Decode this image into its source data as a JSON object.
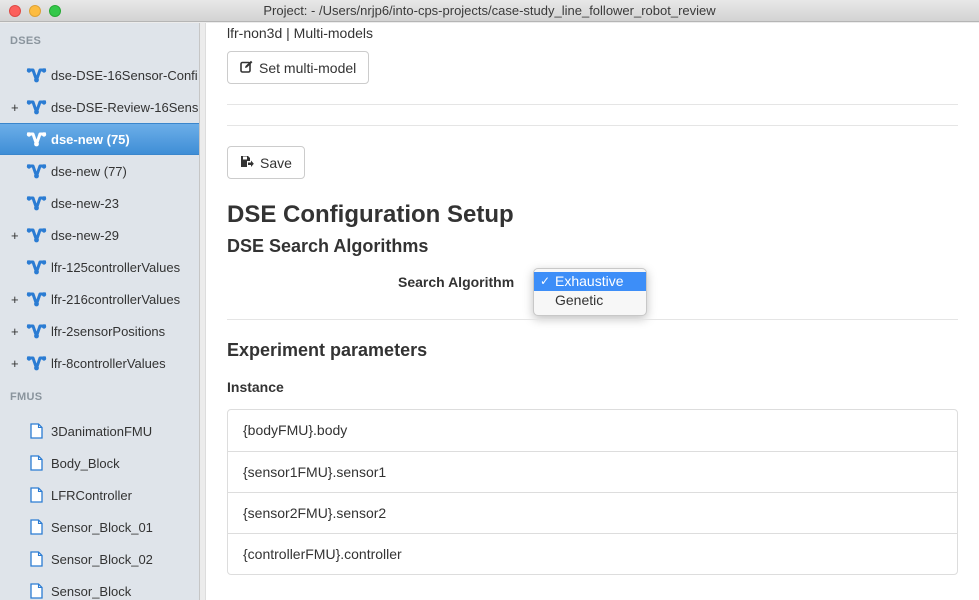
{
  "window": {
    "title": "Project: - /Users/nrjp6/into-cps-projects/case-study_line_follower_robot_review"
  },
  "sidebar": {
    "dses_header": "DSES",
    "dses": [
      {
        "label": "dse-DSE-16Sensor-Confi",
        "expandable": false,
        "selected": false
      },
      {
        "label": "dse-DSE-Review-16Sens",
        "expandable": true,
        "selected": false
      },
      {
        "label": "dse-new (75)",
        "expandable": false,
        "selected": true
      },
      {
        "label": "dse-new (77)",
        "expandable": false,
        "selected": false
      },
      {
        "label": "dse-new-23",
        "expandable": false,
        "selected": false
      },
      {
        "label": "dse-new-29",
        "expandable": true,
        "selected": false
      },
      {
        "label": "lfr-125controllerValues",
        "expandable": false,
        "selected": false
      },
      {
        "label": "lfr-216controllerValues",
        "expandable": true,
        "selected": false
      },
      {
        "label": "lfr-2sensorPositions",
        "expandable": true,
        "selected": false
      },
      {
        "label": "lfr-8controllerValues",
        "expandable": true,
        "selected": false
      }
    ],
    "fmus_header": "FMUS",
    "fmus": [
      {
        "label": "3DanimationFMU"
      },
      {
        "label": "Body_Block"
      },
      {
        "label": "LFRController"
      },
      {
        "label": "Sensor_Block_01"
      },
      {
        "label": "Sensor_Block_02"
      },
      {
        "label": "Sensor_Block"
      }
    ],
    "expand_glyph": "+"
  },
  "main": {
    "breadcrumb": "lfr-non3d | Multi-models",
    "set_multimodel_label": "Set multi-model",
    "save_label": "Save",
    "config_title": "DSE Configuration Setup",
    "search_algorithms_title": "DSE Search Algorithms",
    "search_algorithm_label": "Search Algorithm",
    "search_algorithm_options": [
      "Exhaustive",
      "Genetic"
    ],
    "search_algorithm_selected": "Exhaustive",
    "experiment_title": "Experiment parameters",
    "instance_label": "Instance",
    "instances": [
      "{bodyFMU}.body",
      "{sensor1FMU}.sensor1",
      "{sensor2FMU}.sensor2",
      "{controllerFMU}.controller"
    ]
  },
  "colors": {
    "selection": "#3f8ed6",
    "dse_icon": "#2b7cd3",
    "fmu_icon": "#2b7cd3",
    "dropdown_highlight": "#3d8ef8"
  }
}
